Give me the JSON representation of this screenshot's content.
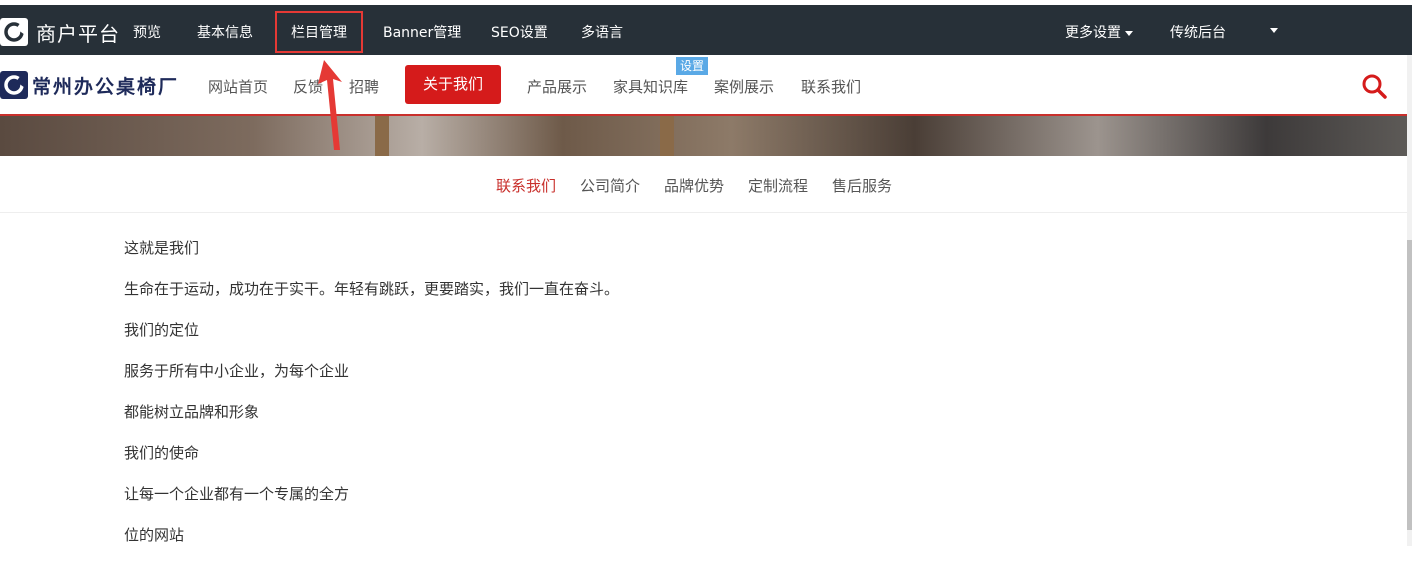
{
  "admin": {
    "brand": "商户平台",
    "nav": [
      "预览",
      "基本信息",
      "栏目管理",
      "Banner管理",
      "SEO设置",
      "多语言"
    ],
    "right": [
      "更多设置",
      "传统后台"
    ]
  },
  "site": {
    "logo_text": "常州办公桌椅厂",
    "nav": [
      "网站首页",
      "反馈",
      "招聘",
      "关于我们",
      "产品展示",
      "家具知识库",
      "案例展示",
      "联系我们"
    ],
    "badge": "设置"
  },
  "subnav": [
    "联系我们",
    "公司简介",
    "品牌优势",
    "定制流程",
    "售后服务"
  ],
  "content": [
    "这就是我们",
    "生命在于运动，成功在于实干。年轻有跳跃，更要踏实，我们一直在奋斗。",
    "我们的定位",
    "服务于所有中小企业，为每个企业",
    "都能树立品牌和形象",
    "我们的使命",
    "让每一个企业都有一个专属的全方",
    "位的网站"
  ],
  "colors": {
    "admin_bg": "#273038",
    "accent": "#d51b1b",
    "highlight": "#e53935",
    "badge": "#5aa9e6"
  }
}
